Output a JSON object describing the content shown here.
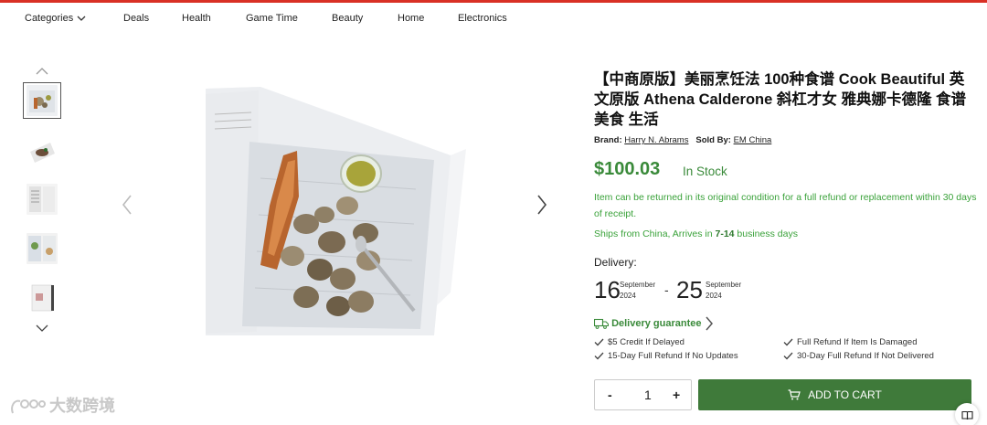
{
  "nav": {
    "items": [
      "Categories",
      "Deals",
      "Health",
      "Game Time",
      "Beauty",
      "Home",
      "Electronics"
    ]
  },
  "product": {
    "title": "【中商原版】美丽烹饪法 100种食谱 Cook Beautiful 英文原版 Athena Calderone 斜杠才女 雅典娜卡德隆 食谱 美食 生活",
    "brand_label": "Brand:",
    "brand": "Harry N. Abrams",
    "sold_by_label": "Sold By:",
    "sold_by": "EM China",
    "price": "$100.03",
    "stock": "In Stock",
    "returns": "Item can be returned in its original condition for a full refund or replacement within 30 days of receipt.",
    "ships_prefix": "Ships from China, Arrives in",
    "ships_days": "7-14",
    "ships_suffix": "business days"
  },
  "delivery": {
    "label": "Delivery:",
    "from_day": "16",
    "from_month": "September",
    "from_year": "2024",
    "separator": "-",
    "to_day": "25",
    "to_month": "September",
    "to_year": "2024",
    "guarantee": "Delivery guarantee",
    "bullets": [
      "$5 Credit If Delayed",
      "Full Refund If Item Is Damaged",
      "15-Day Full Refund If No Updates",
      "30-Day Full Refund If Not Delivered"
    ]
  },
  "cart": {
    "minus": "-",
    "quantity": "1",
    "plus": "+",
    "add_label": "ADD TO CART"
  },
  "watermark": "大数跨境",
  "colors": {
    "accent_red": "#d93025",
    "price_green": "#3a8a3a",
    "cart_green": "#3f7a3a"
  },
  "icons": [
    "chevron-down-icon",
    "chevron-up-icon",
    "chevron-left-icon",
    "chevron-right-icon",
    "truck-icon",
    "check-icon",
    "cart-icon",
    "reader-icon"
  ]
}
